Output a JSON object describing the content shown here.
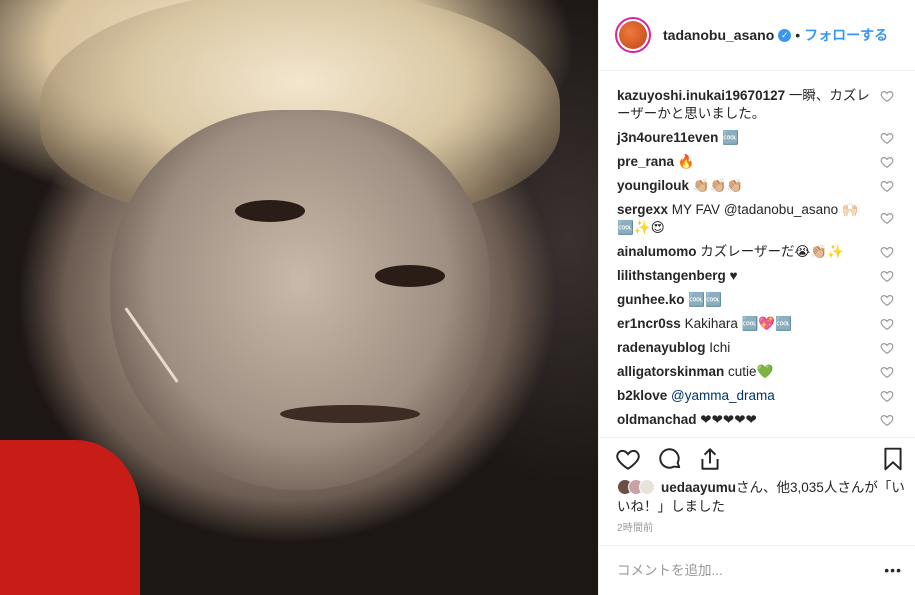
{
  "post": {
    "image_alt": "photo",
    "author": "tadanobu_asano",
    "follow_label": "フォローする"
  },
  "comments": [
    {
      "user": "kazuyoshi.inukai19670127",
      "text": " 一瞬、カズレーザーかと思いました。"
    },
    {
      "user": "j3n4oure11even",
      "text": " 🆒"
    },
    {
      "user": "pre_rana",
      "text": " 🔥"
    },
    {
      "user": "youngilouk",
      "text": " 👏🏼👏🏼👏🏼"
    },
    {
      "user": "sergexx",
      "text": " MY FAV @tadanobu_asano 🙌🏻🆒✨😍"
    },
    {
      "user": "ainalumomo",
      "text": " カズレーザーだ😭👏🏼✨"
    },
    {
      "user": "lilithstangenberg",
      "text": " ♥"
    },
    {
      "user": "gunhee.ko",
      "text": " 🆒🆒"
    },
    {
      "user": "er1ncr0ss",
      "text": " Kakihara 🆒💖🆒"
    },
    {
      "user": "radenayublog",
      "text": " Ichi"
    },
    {
      "user": "alligatorskinman",
      "text": " cutie💚"
    },
    {
      "user": "b2klove",
      "text": " @yamma_drama"
    },
    {
      "user": "oldmanchad",
      "text": " ❤❤❤❤❤"
    }
  ],
  "likes": {
    "user": "uedaayumu",
    "text": "さん、他3,035人さんが「いいね！」しました"
  },
  "timestamp": "2時間前",
  "add_comment": {
    "placeholder": "コメントを追加...",
    "more": "•••"
  },
  "colors": {
    "accent": "#3897f0",
    "text": "#262626",
    "muted": "#999999",
    "border": "#efefef"
  },
  "icons": [
    "verified-badge-icon",
    "heart-icon",
    "comment-icon",
    "share-icon",
    "bookmark-icon",
    "more-icon"
  ]
}
